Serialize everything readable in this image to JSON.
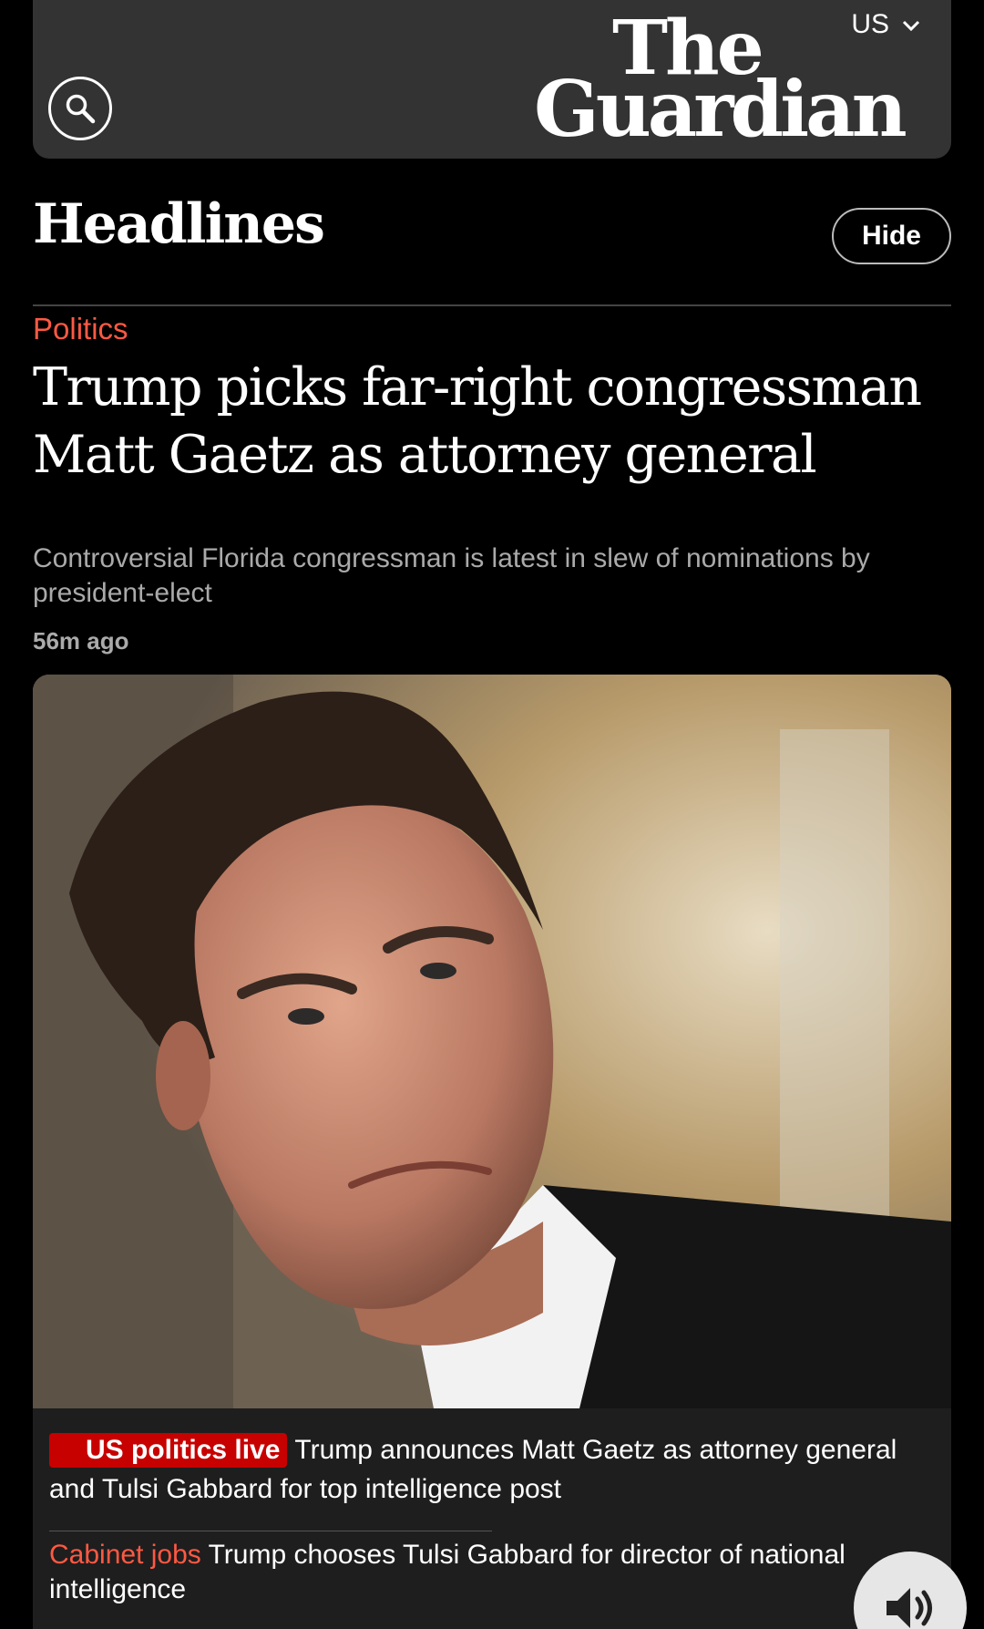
{
  "header": {
    "edition": "US",
    "logo_line1": "The",
    "logo_line2": "Guardian"
  },
  "section": {
    "title": "Headlines",
    "hide_label": "Hide"
  },
  "lead": {
    "kicker": "Politics",
    "headline": "Trump picks far-right congressman Matt Gaetz as attorney general",
    "standfirst": "Controversial Florida congressman is latest in slew of nominations by president-elect",
    "timestamp": "56m ago",
    "image_alt_icon": "photo-of-man-in-suit"
  },
  "sublinks": [
    {
      "badge": "US politics live",
      "text": "Trump announces Matt Gaetz as attorney general and Tulsi Gabbard for top intelligence post"
    },
    {
      "kicker": "Cabinet jobs",
      "text": "Trump chooses Tulsi Gabbard for director of national intelligence"
    }
  ],
  "colors": {
    "background": "#000000",
    "masthead": "#333333",
    "accent_red": "#ff5943",
    "live_badge": "#c70000",
    "muted_text": "#aaaaaa"
  },
  "icons": {
    "search": "search-icon",
    "chevron": "chevron-down-icon",
    "audio": "speaker-icon",
    "live": "live-dot-icon"
  }
}
